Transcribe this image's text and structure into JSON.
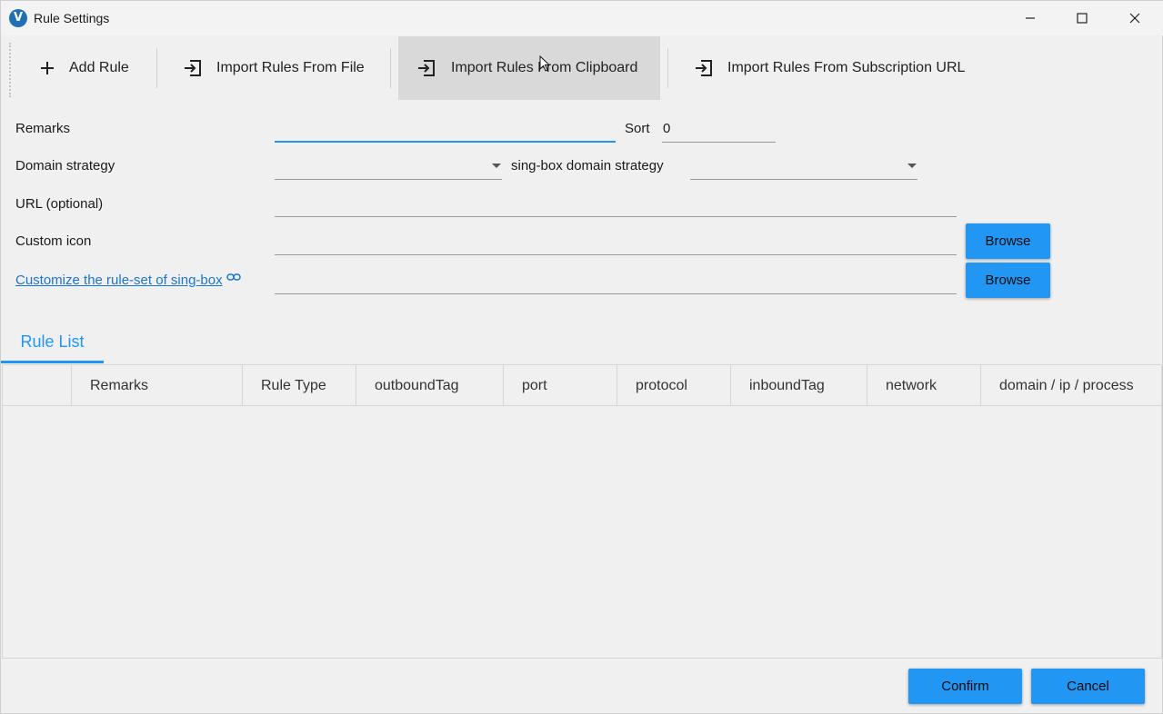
{
  "window": {
    "title": "Rule Settings",
    "logo_letter": "V"
  },
  "toolbar": {
    "add_rule": "Add Rule",
    "import_file": "Import Rules From File",
    "import_clipboard": "Import Rules From Clipboard",
    "import_subscription": "Import Rules From Subscription URL"
  },
  "form": {
    "remarks_label": "Remarks",
    "remarks_value": "",
    "sort_label": "Sort",
    "sort_value": "0",
    "domain_strategy_label": "Domain strategy",
    "domain_strategy_value": "",
    "singbox_domain_strategy_label": "sing-box domain strategy",
    "singbox_domain_strategy_value": "",
    "url_label": "URL (optional)",
    "url_value": "",
    "custom_icon_label": "Custom icon",
    "custom_icon_value": "",
    "ruleset_link": "Customize the rule-set of sing-box",
    "ruleset_value": "",
    "browse_label": "Browse"
  },
  "tabs": [
    {
      "label": "Rule List",
      "selected": true
    }
  ],
  "table": {
    "columns": [
      "",
      "Remarks",
      "Rule Type",
      "outboundTag",
      "port",
      "protocol",
      "inboundTag",
      "network",
      "domain / ip / process"
    ],
    "rows": []
  },
  "footer": {
    "confirm": "Confirm",
    "cancel": "Cancel"
  },
  "colors": {
    "accent": "#2196f3",
    "link": "#1976d2",
    "background": "#f0f0f0"
  }
}
